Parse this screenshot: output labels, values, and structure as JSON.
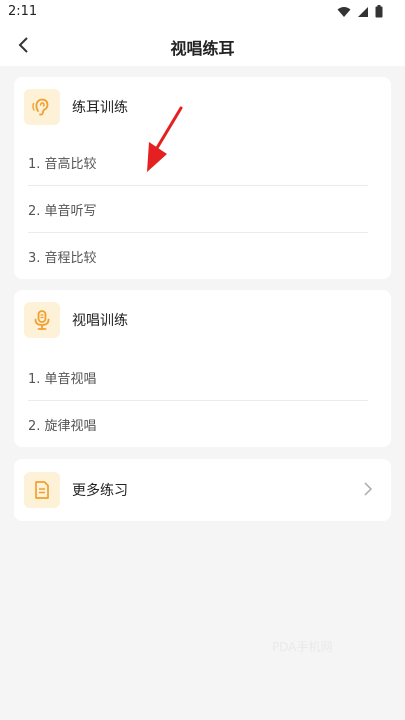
{
  "status": {
    "time": "2:11"
  },
  "header": {
    "title": "视唱练耳"
  },
  "ear_training": {
    "title": "练耳训练",
    "items": [
      "1. 音高比较",
      "2. 单音听写",
      "3. 音程比较"
    ]
  },
  "sight_singing": {
    "title": "视唱训练",
    "items": [
      "1. 单音视唱",
      "2. 旋律视唱"
    ]
  },
  "more": {
    "title": "更多练习"
  },
  "watermark": "PDA手机网",
  "colors": {
    "accent": "#f0a030",
    "icon_bg": "#fdf1d8",
    "annotation_arrow": "#e52020"
  }
}
